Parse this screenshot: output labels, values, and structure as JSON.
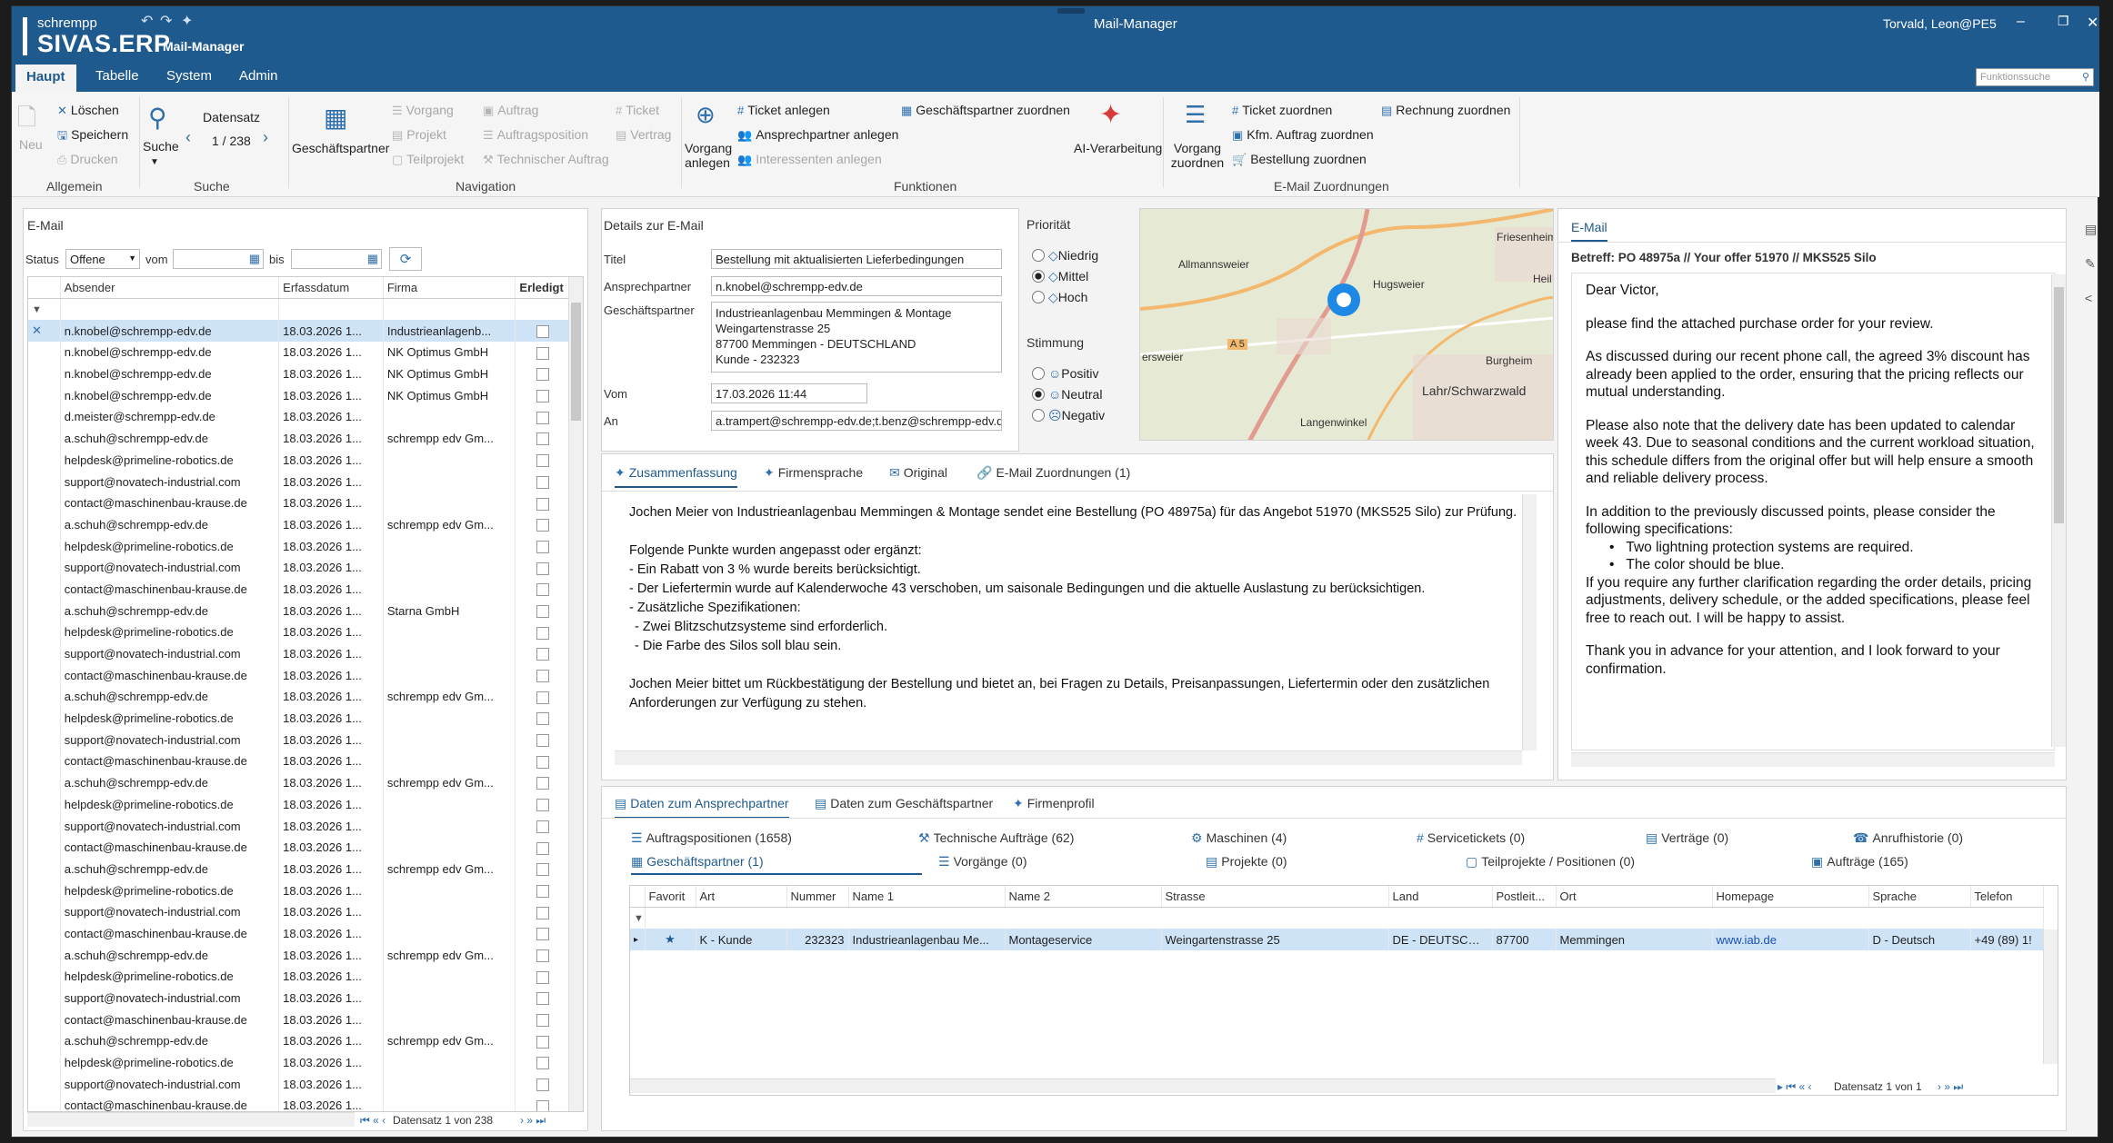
{
  "app": {
    "brand_top": "schrempp",
    "brand_main": "SIVAS.ERP",
    "brand_sub": "Mail-Manager",
    "window_title": "Mail-Manager",
    "user": "Torvald, Leon@PE5"
  },
  "menu": {
    "tabs": [
      "Haupt",
      "Tabelle",
      "System",
      "Admin"
    ],
    "search_placeholder": "Funktionssuche"
  },
  "ribbon": {
    "allgemein": {
      "neu": "Neu",
      "loeschen": "Löschen",
      "speichern": "Speichern",
      "drucken": "Drucken",
      "group": "Allgemein"
    },
    "suche": {
      "suche": "Suche",
      "datensatz": "Datensatz",
      "counter": "1 / 238",
      "group": "Suche"
    },
    "navigation": {
      "gp": "Geschäftspartner",
      "vorgang": "Vorgang",
      "projekt": "Projekt",
      "teilprojekt": "Teilprojekt",
      "auftrag": "Auftrag",
      "auftragsposition": "Auftragsposition",
      "technischer_auftrag": "Technischer Auftrag",
      "ticket": "Ticket",
      "vertrag": "Vertrag",
      "group": "Navigation"
    },
    "funktionen": {
      "vorgang_anlegen": "Vorgang anlegen",
      "ticket_anlegen": "Ticket anlegen",
      "ansprechpartner_anlegen": "Ansprechpartner anlegen",
      "interessenten_anlegen": "Interessenten anlegen",
      "gp_zuordnen": "Geschäftspartner zuordnen",
      "ai": "AI-Verarbeitung",
      "group": "Funktionen"
    },
    "zuordnungen": {
      "vorgang_zuordnen": "Vorgang zuordnen",
      "ticket_zuordnen": "Ticket zuordnen",
      "kfm": "Kfm. Auftrag zuordnen",
      "bestellung": "Bestellung zuordnen",
      "rechnung": "Rechnung zuordnen",
      "group": "E-Mail Zuordnungen"
    }
  },
  "email_list": {
    "title": "E-Mail",
    "status_label": "Status",
    "status_value": "Offene",
    "vom_label": "vom",
    "bis_label": "bis",
    "columns": [
      "Absender",
      "Erfassdatum",
      "Firma",
      "Erledigt"
    ],
    "rows": [
      [
        "n.knobel@schrempp-edv.de",
        "18.03.2026 1...",
        "Industrieanlagenb..."
      ],
      [
        "n.knobel@schrempp-edv.de",
        "18.03.2026 1...",
        "NK Optimus GmbH"
      ],
      [
        "n.knobel@schrempp-edv.de",
        "18.03.2026 1...",
        "NK Optimus GmbH"
      ],
      [
        "n.knobel@schrempp-edv.de",
        "18.03.2026 1...",
        "NK Optimus GmbH"
      ],
      [
        "d.meister@schrempp-edv.de",
        "18.03.2026 1...",
        ""
      ],
      [
        "a.schuh@schrempp-edv.de",
        "18.03.2026 1...",
        "schrempp edv Gm..."
      ],
      [
        "helpdesk@primeline-robotics.de",
        "18.03.2026 1...",
        ""
      ],
      [
        "support@novatech-industrial.com",
        "18.03.2026 1...",
        ""
      ],
      [
        "contact@maschinenbau-krause.de",
        "18.03.2026 1...",
        ""
      ],
      [
        "a.schuh@schrempp-edv.de",
        "18.03.2026 1...",
        "schrempp edv Gm..."
      ],
      [
        "helpdesk@primeline-robotics.de",
        "18.03.2026 1...",
        ""
      ],
      [
        "support@novatech-industrial.com",
        "18.03.2026 1...",
        ""
      ],
      [
        "contact@maschinenbau-krause.de",
        "18.03.2026 1...",
        ""
      ],
      [
        "a.schuh@schrempp-edv.de",
        "18.03.2026 1...",
        "Starna GmbH"
      ],
      [
        "helpdesk@primeline-robotics.de",
        "18.03.2026 1...",
        ""
      ],
      [
        "support@novatech-industrial.com",
        "18.03.2026 1...",
        ""
      ],
      [
        "contact@maschinenbau-krause.de",
        "18.03.2026 1...",
        ""
      ],
      [
        "a.schuh@schrempp-edv.de",
        "18.03.2026 1...",
        "schrempp edv Gm..."
      ],
      [
        "helpdesk@primeline-robotics.de",
        "18.03.2026 1...",
        ""
      ],
      [
        "support@novatech-industrial.com",
        "18.03.2026 1...",
        ""
      ],
      [
        "contact@maschinenbau-krause.de",
        "18.03.2026 1...",
        ""
      ],
      [
        "a.schuh@schrempp-edv.de",
        "18.03.2026 1...",
        "schrempp edv Gm..."
      ],
      [
        "helpdesk@primeline-robotics.de",
        "18.03.2026 1...",
        ""
      ],
      [
        "support@novatech-industrial.com",
        "18.03.2026 1...",
        ""
      ],
      [
        "contact@maschinenbau-krause.de",
        "18.03.2026 1...",
        ""
      ],
      [
        "a.schuh@schrempp-edv.de",
        "18.03.2026 1...",
        "schrempp edv Gm..."
      ],
      [
        "helpdesk@primeline-robotics.de",
        "18.03.2026 1...",
        ""
      ],
      [
        "support@novatech-industrial.com",
        "18.03.2026 1...",
        ""
      ],
      [
        "contact@maschinenbau-krause.de",
        "18.03.2026 1...",
        ""
      ],
      [
        "a.schuh@schrempp-edv.de",
        "18.03.2026 1...",
        "schrempp edv Gm..."
      ],
      [
        "helpdesk@primeline-robotics.de",
        "18.03.2026 1...",
        ""
      ],
      [
        "support@novatech-industrial.com",
        "18.03.2026 1...",
        ""
      ],
      [
        "contact@maschinenbau-krause.de",
        "18.03.2026 1...",
        ""
      ],
      [
        "a.schuh@schrempp-edv.de",
        "18.03.2026 1...",
        "schrempp edv Gm..."
      ],
      [
        "helpdesk@primeline-robotics.de",
        "18.03.2026 1...",
        ""
      ],
      [
        "support@novatech-industrial.com",
        "18.03.2026 1...",
        ""
      ],
      [
        "contact@maschinenbau-krause.de",
        "18.03.2026 1...",
        ""
      ]
    ],
    "pager": "Datensatz 1 von 238"
  },
  "details": {
    "title": "Details zur E-Mail",
    "titel_label": "Titel",
    "titel_value": "Bestellung mit aktualisierten Lieferbedingungen",
    "ansprechpartner_label": "Ansprechpartner",
    "ansprechpartner_value": "n.knobel@schrempp-edv.de",
    "gp_label": "Geschäftspartner",
    "gp_lines": [
      "Industrieanlagenbau Memmingen & Montage",
      "Weingartenstrasse 25",
      "87700 Memmingen - DEUTSCHLAND",
      "Kunde - 232323"
    ],
    "vom_label": "Vom",
    "vom_value": "17.03.2026 11:44",
    "an_label": "An",
    "an_value": "a.trampert@schrempp-edv.de;t.benz@schrempp-edv.de"
  },
  "prioritaet": {
    "title": "Priorität",
    "options": [
      "Niedrig",
      "Mittel",
      "Hoch"
    ],
    "selected": "Mittel"
  },
  "stimmung": {
    "title": "Stimmung",
    "options": [
      "Positiv",
      "Neutral",
      "Negativ"
    ],
    "selected": "Neutral"
  },
  "map": {
    "labels": [
      "Friesenheim",
      "Allmannsweier",
      "Hugsweier",
      "Heil",
      "Burgheim",
      "Lahr/Schwarzwald",
      "Langenwinkel",
      "A 5",
      "ersweier"
    ]
  },
  "summary_tabs": [
    "Zusammenfassung",
    "Firmensprache",
    "Original",
    "E-Mail Zuordnungen (1)"
  ],
  "summary": {
    "intro": "Jochen Meier von Industrieanlagenbau Memmingen & Montage sendet eine Bestellung (PO 48975a) für das Angebot 51970 (MKS525 Silo) zur Prüfung.",
    "lines": [
      "Folgende Punkte wurden angepasst oder ergänzt:",
      "- Ein Rabatt von 3 % wurde bereits berücksichtigt.",
      "- Der Liefertermin wurde auf Kalenderwoche 43 verschoben, um saisonale Bedingungen und die aktuelle Auslastung zu berücksichtigen.",
      "- Zusätzliche Spezifikationen:",
      "  - Zwei Blitzschutzsysteme sind erforderlich.",
      "  - Die Farbe des Silos soll blau sein."
    ],
    "outro": "Jochen Meier bittet um Rückbestätigung der Bestellung und bietet an, bei Fragen zu Details, Preisanpassungen, Liefertermin oder den zusätzlichen Anforderungen zur Verfügung zu stehen."
  },
  "email_view": {
    "tab": "E-Mail",
    "betreff": "Betreff:  PO 48975a // Your offer 51970 // MKS525 Silo",
    "greeting": "Dear Victor,",
    "p1": "please find the attached purchase order for your review.",
    "p2": "As discussed during our recent phone call, the agreed 3% discount has already been applied to the order, ensuring that the pricing reflects our mutual understanding.",
    "p3": "Please also note that the delivery date has been updated to calendar week 43. Due to seasonal conditions and the current workload situation, this schedule differs from the original offer but will help ensure a smooth and reliable delivery process.",
    "p4": "In addition to the previously discussed points, please consider the following specifications:",
    "bullets": [
      "Two lightning protection systems are required.",
      "The color should be blue."
    ],
    "p5": "If you require any further clarification regarding the order details, pricing adjustments, delivery schedule, or the added specifications, please feel free to reach out. I will be happy to assist.",
    "p6": "Thank you in advance for your attention, and I look forward to your confirmation."
  },
  "bottom_tabs": [
    "Daten zum Ansprechpartner",
    "Daten zum Geschäftspartner",
    "Firmenprofil"
  ],
  "sub_tabs_row1": [
    "Auftragspositionen (1658)",
    "Technische Aufträge (62)",
    "Maschinen (4)",
    "Servicetickets (0)",
    "Verträge (0)",
    "Anrufhistorie (0)"
  ],
  "sub_tabs_row2": [
    "Geschäftspartner (1)",
    "Vorgänge (0)",
    "Projekte (0)",
    "Teilprojekte / Positionen (0)",
    "Aufträge (165)"
  ],
  "gp_table": {
    "columns": [
      "Favorit",
      "Art",
      "Nummer",
      "Name 1",
      "Name 2",
      "Strasse",
      "Land",
      "Postleit...",
      "Ort",
      "Homepage",
      "Sprache",
      "Telefon"
    ],
    "row": [
      "",
      "K - Kunde",
      "232323",
      "Industrieanlagenbau Me...",
      "Montageservice",
      "Weingartenstrasse 25",
      "DE - DEUTSCHL...",
      "87700",
      "Memmingen",
      "www.iab.de",
      "D - Deutsch",
      "+49 (89) 1!"
    ],
    "pager": "Datensatz 1 von 1"
  }
}
